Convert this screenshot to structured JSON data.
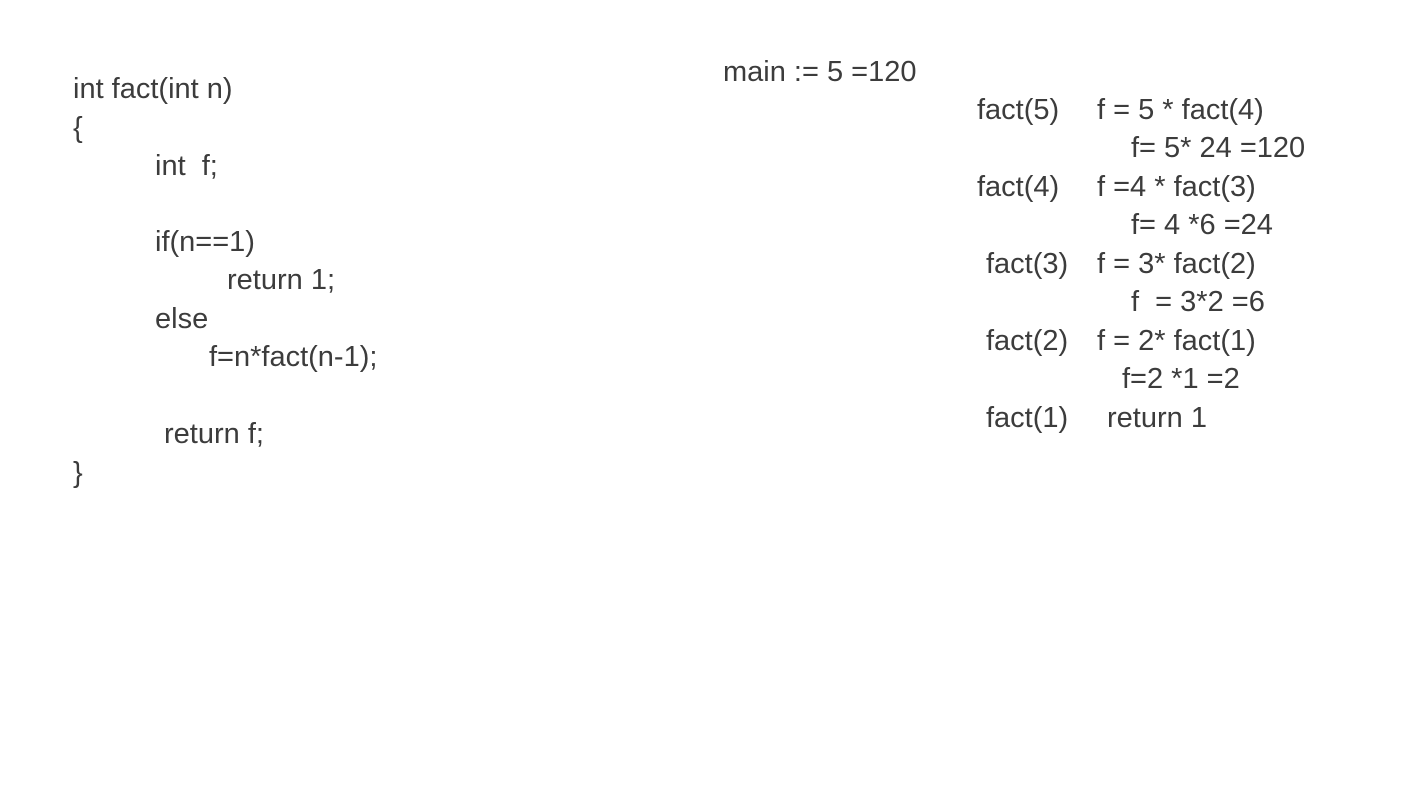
{
  "code": {
    "lines": [
      "int fact(int n)",
      "{",
      "int  f;",
      "if(n==1)",
      "return 1;",
      "else",
      "f=n*fact(n-1);",
      "return f;",
      "}"
    ]
  },
  "trace": {
    "main": "main := 5 =120",
    "calls": [
      {
        "call": "fact(5)",
        "step": "f = 5 * fact(4)"
      },
      {
        "call": "fact(4)",
        "step": "f =4 * fact(3)"
      },
      {
        "call": "fact(3)",
        "step": "f = 3* fact(2)"
      },
      {
        "call": "fact(2)",
        "step": "f = 2* fact(1)"
      },
      {
        "call": "fact(1)",
        "step": "return 1"
      }
    ],
    "results": [
      "f= 5* 24 =120",
      "f= 4 *6 =24",
      "f  = 3*2 =6",
      "f=2 *1 =2"
    ]
  },
  "colors": {
    "text": "#3c3c3c",
    "background": "#ffffff"
  }
}
